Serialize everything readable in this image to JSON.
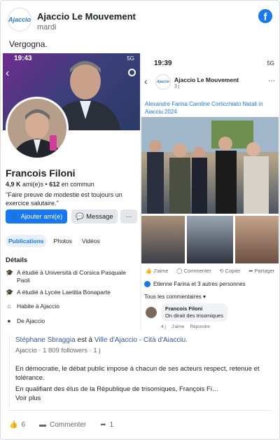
{
  "post": {
    "page_name": "Ajaccio Le Mouvement",
    "logo_text": "Ajaccio",
    "date": "mardi",
    "text": "Vergogna."
  },
  "profile_shot": {
    "time": "19:43",
    "network": "5G",
    "name": "Francois Filoni",
    "friends_count": "4,9 K",
    "friends_label": "ami(e)s",
    "common_count": "612",
    "common_label": "en commun",
    "quote": "\"Faire preuve de modestie est toujours un exercice salutaire.\"",
    "add_friend": "Ajouter ami(e)",
    "message": "Message",
    "more": "···",
    "tabs": [
      "Publications",
      "Photos",
      "Vidéos"
    ],
    "details_title": "Détails",
    "details": [
      {
        "icon": "graduation-icon",
        "text": "A étudié à Università di Corsica Pasquale Paoli"
      },
      {
        "icon": "graduation-icon",
        "text": "A étudié à Lycée Laetitia Bonaparte"
      },
      {
        "icon": "home-icon",
        "text": "Habite à Ajaccio"
      },
      {
        "icon": "pin-icon",
        "text": "De Ajaccio"
      }
    ]
  },
  "post_shot": {
    "time": "19:39",
    "network": "5G",
    "page_name": "Ajaccio Le Mouvement",
    "date": "3 j ·",
    "tagline": "Alexandre Farina Caroline Corticchiato Natali in Aiacciu 2024",
    "actions": [
      "J'aime",
      "Commenter",
      "Copier",
      "Partager"
    ],
    "likers": "Etienne Farina et 3 autres personnes",
    "all_comments": "Tous les commentaires ▾",
    "comment_author": "Francois Filoni",
    "comment_text": "On dirait des trisomiques",
    "comment_meta": [
      "4 j",
      "J'aime",
      "Répondre"
    ]
  },
  "comment": {
    "author": "Stéphane Sbraggia",
    "connector": "est à",
    "place": "Ville d'Ajaccio - Cità d'Aiacciu.",
    "meta": "Ajaccio · 1 809 followers · 1 j",
    "body1": "En démocratie, le débat public impose à chacun de ses acteurs respect, retenue et tolérance.",
    "body2": "En qualifiant des élus de la République de trisomiques, François Fi…",
    "more": "Voir plus"
  },
  "footer": {
    "likes": "6",
    "comment": "Commenter",
    "shares": "1"
  },
  "colors": {
    "brand": "#1877f2",
    "link": "#385898"
  }
}
